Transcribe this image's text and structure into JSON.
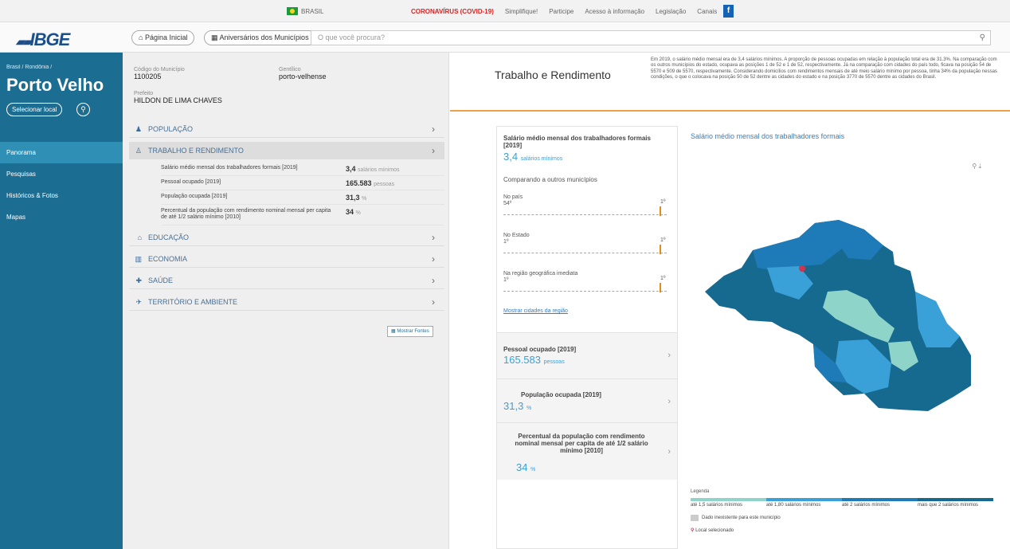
{
  "gov_bar": {
    "country": "BRASIL",
    "links": [
      "CORONAVÍRUS (COVID-19)",
      "Simplifique!",
      "Participe",
      "Acesso à informação",
      "Legislação",
      "Canais"
    ]
  },
  "header": {
    "logo": "IBGE",
    "home_button": "Página Inicial",
    "yearbook_button": "Aniversários dos Municípios",
    "search_placeholder": "O que você procura?"
  },
  "sidebar": {
    "breadcrumb": "Brasil / Rondônia /",
    "city": "Porto Velho",
    "select_button": "Selecionar local",
    "nav": [
      "Panorama",
      "Pesquisas",
      "Históricos & Fotos",
      "Mapas"
    ],
    "active_index": 0
  },
  "profile": {
    "code_label": "Código do Município",
    "code_value": "1100205",
    "gentilic_label": "Gentílico",
    "gentilic_value": "porto-velhense",
    "mayor_label": "Prefeito",
    "mayor_value": "HILDON DE LIMA CHAVES"
  },
  "groups": [
    {
      "label": "POPULAÇÃO",
      "icon": "people-icon"
    },
    {
      "label": "TRABALHO E RENDIMENTO",
      "icon": "person-icon"
    },
    {
      "label": "EDUCAÇÃO",
      "icon": "graduation-icon"
    },
    {
      "label": "ECONOMIA",
      "icon": "chart-icon"
    },
    {
      "label": "SAÚDE",
      "icon": "health-icon"
    },
    {
      "label": "TERRITÓRIO E AMBIENTE",
      "icon": "plane-icon"
    }
  ],
  "work_rows": [
    {
      "label": "Salário médio mensal dos trabalhadores formais [2019]",
      "value": "3,4",
      "unit": "salários mínimos"
    },
    {
      "label": "Pessoal ocupado [2019]",
      "value": "165.583",
      "unit": "pessoas"
    },
    {
      "label": "População ocupada [2019]",
      "value": "31,3",
      "unit": "%"
    },
    {
      "label": "Percentual da população com rendimento nominal mensal per capita de até 1/2 salário mínimo [2010]",
      "value": "34",
      "unit": "%"
    }
  ],
  "sources_button": "Mostrar Fontes",
  "right": {
    "title": "Trabalho e Rendimento",
    "text": "Em 2019, o salário médio mensal era de 3,4 salários mínimos. A proporção de pessoas ocupadas em relação à população total era de 31.3%. Na comparação com os outros municípios do estado, ocupava as posições 1 de 52 e 1 de 52, respectivamente. Já na comparação com cidades do país todo, ficava na posição 54 de 5570 e 509 de 5570, respectivamente. Considerando domicílios com rendimentos mensais de até meio salário mínimo por pessoa, tinha 34% da população nessas condições, o que o colocava na posição 50 de 52 dentre as cidades do estado e na posição 3770 de 5570 dentre as cidades do Brasil."
  },
  "card": {
    "salary_title": "Salário médio mensal dos trabalhadores formais [2019]",
    "salary_value": "3,4",
    "salary_unit": "salários mínimos",
    "compare_label": "Comparando a outros municípios",
    "country_label": "No país",
    "country_rank": "54º",
    "state_label": "No Estado",
    "state_rank": "1º",
    "region_label": "Na região geográfica imediata",
    "region_rank": "1º",
    "scale_top": "1º",
    "more_link": "Mostrar cidades da região",
    "occupied_title": "Pessoal ocupado [2019]",
    "occupied_value": "165.583",
    "occupied_unit": "pessoas",
    "pop_title": "População ocupada [2019]",
    "pop_value": "31,3",
    "pop_unit": "%",
    "percent_title": "Percentual da população com rendimento nominal mensal per capita de até 1/2 salário mínimo [2010]",
    "percent_value": "34",
    "percent_unit": "%"
  },
  "map": {
    "title": "Salário médio mensal dos trabalhadores formais",
    "tools": "🔍 ⬇",
    "legend_title": "Legenda",
    "legend_items": [
      "até 1,5 salários mínimos",
      "até 1,80 salários mínimos",
      "até 2 salários mínimos",
      "mais que 2 salários mínimos"
    ],
    "legend_colors": [
      "#8fd4c9",
      "#3aa0d8",
      "#1f7bb8",
      "#166a90"
    ],
    "no_data": "Dado inexistente para este município",
    "selected_place": "Local selecionado"
  }
}
